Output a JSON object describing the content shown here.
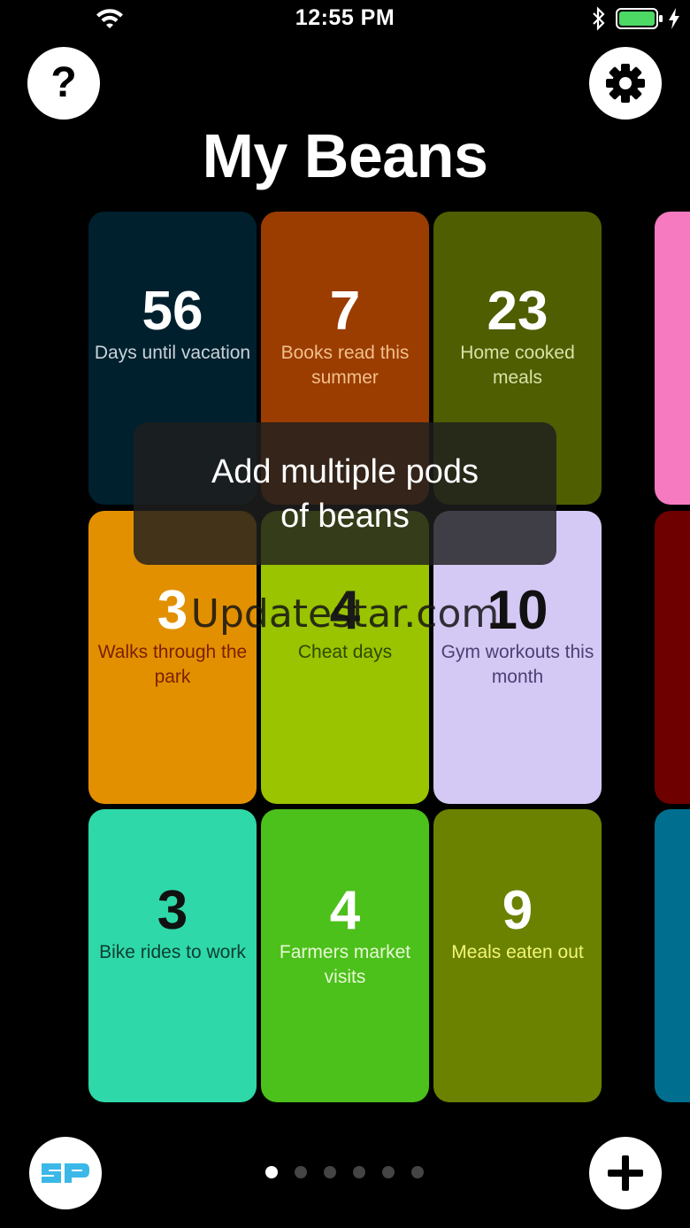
{
  "status_bar": {
    "time": "12:55 PM",
    "battery_color": "#4cd964"
  },
  "header": {
    "title": "My Beans",
    "help_label": "?"
  },
  "tiles": [
    {
      "value": "56",
      "label": "Days until vacation",
      "bg": "#00202e",
      "value_color": "#ffffff",
      "label_color": "#c9d3d8"
    },
    {
      "value": "7",
      "label": "Books read this summer",
      "bg": "#9b3c00",
      "value_color": "#ffffff",
      "label_color": "#f1c08a"
    },
    {
      "value": "23",
      "label": "Home cooked meals",
      "bg": "#4f5e00",
      "value_color": "#ffffff",
      "label_color": "#d9e2a6"
    },
    {
      "value": "3",
      "label": "Walks through the park",
      "bg": "#e39000",
      "value_color": "#ffffff",
      "label_color": "#7a1f00"
    },
    {
      "value": "4",
      "label": "Cheat days",
      "bg": "#9ac300",
      "value_color": "#1a1a1a",
      "label_color": "#2e4a00"
    },
    {
      "value": "10",
      "label": "Gym workouts this month",
      "bg": "#d4c9f5",
      "value_color": "#111111",
      "label_color": "#4d3f74"
    },
    {
      "value": "3",
      "label": "Bike rides to work",
      "bg": "#2fd8a8",
      "value_color": "#111111",
      "label_color": "#0c3d33"
    },
    {
      "value": "4",
      "label": "Farmers market visits",
      "bg": "#4cc01b",
      "value_color": "#ffffff",
      "label_color": "#e7f8d4"
    },
    {
      "value": "9",
      "label": "Meals eaten out",
      "bg": "#6b8200",
      "value_color": "#ffffff",
      "label_color": "#f2f57a"
    }
  ],
  "edge_tiles": [
    {
      "bg": "#f57ac0"
    },
    {
      "bg": "#6e0000"
    },
    {
      "bg": "#006f8f"
    }
  ],
  "toast": {
    "line1": "Add multiple pods",
    "line2": "of beans"
  },
  "watermark": "Updatestar.com",
  "pagination": {
    "active_index": 0,
    "count": 6
  }
}
